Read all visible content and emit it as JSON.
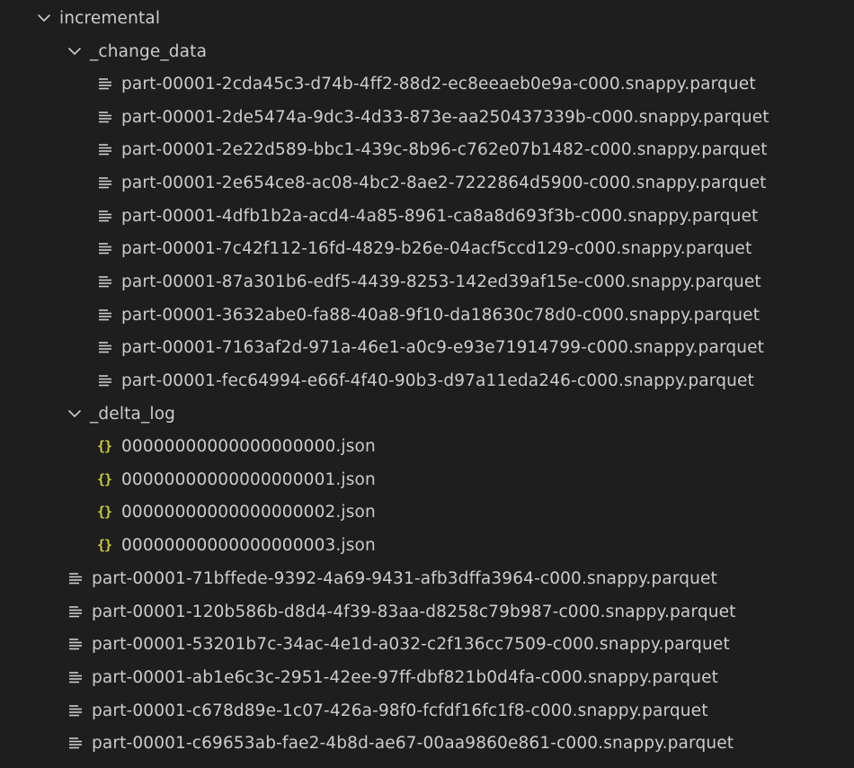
{
  "colors": {
    "background": "#1e1e1e",
    "text": "#cccccc",
    "json_icon": "#cbcb41"
  },
  "root": {
    "label": "incremental",
    "icon": "chevron-down-icon",
    "expanded": true
  },
  "change_data": {
    "label": "_change_data",
    "icon": "chevron-down-icon",
    "expanded": true,
    "files": [
      "part-00001-2cda45c3-d74b-4ff2-88d2-ec8eeaeb0e9a-c000.snappy.parquet",
      "part-00001-2de5474a-9dc3-4d33-873e-aa250437339b-c000.snappy.parquet",
      "part-00001-2e22d589-bbc1-439c-8b96-c762e07b1482-c000.snappy.parquet",
      "part-00001-2e654ce8-ac08-4bc2-8ae2-7222864d5900-c000.snappy.parquet",
      "part-00001-4dfb1b2a-acd4-4a85-8961-ca8a8d693f3b-c000.snappy.parquet",
      "part-00001-7c42f112-16fd-4829-b26e-04acf5ccd129-c000.snappy.parquet",
      "part-00001-87a301b6-edf5-4439-8253-142ed39af15e-c000.snappy.parquet",
      "part-00001-3632abe0-fa88-40a8-9f10-da18630c78d0-c000.snappy.parquet",
      "part-00001-7163af2d-971a-46e1-a0c9-e93e71914799-c000.snappy.parquet",
      "part-00001-fec64994-e66f-4f40-90b3-d97a11eda246-c000.snappy.parquet"
    ]
  },
  "delta_log": {
    "label": "_delta_log",
    "icon": "chevron-down-icon",
    "expanded": true,
    "json_icon_glyph": "{}",
    "files": [
      "00000000000000000000.json",
      "00000000000000000001.json",
      "00000000000000000002.json",
      "00000000000000000003.json"
    ]
  },
  "root_files": [
    "part-00001-71bffede-9392-4a69-9431-afb3dffa3964-c000.snappy.parquet",
    "part-00001-120b586b-d8d4-4f39-83aa-d8258c79b987-c000.snappy.parquet",
    "part-00001-53201b7c-34ac-4e1d-a032-c2f136cc7509-c000.snappy.parquet",
    "part-00001-ab1e6c3c-2951-42ee-97ff-dbf821b0d4fa-c000.snappy.parquet",
    "part-00001-c678d89e-1c07-426a-98f0-fcfdf16fc1f8-c000.snappy.parquet",
    "part-00001-c69653ab-fae2-4b8d-ae67-00aa9860e861-c000.snappy.parquet"
  ]
}
